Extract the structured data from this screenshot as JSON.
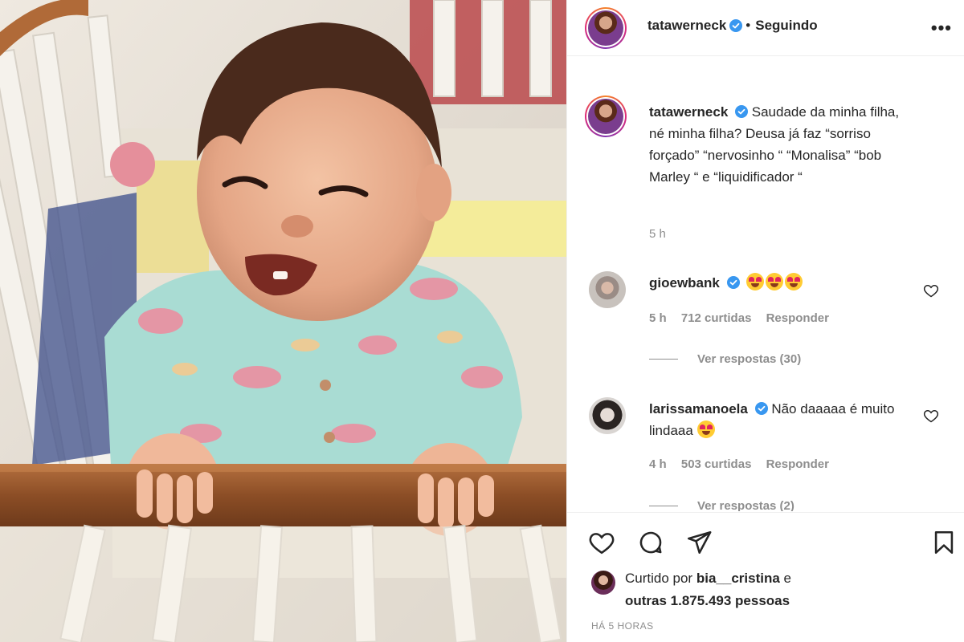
{
  "post": {
    "image_alt": "Bebê sorrindo no berço"
  },
  "header": {
    "username": "tatawerneck",
    "separator": "•",
    "follow_status": "Seguindo",
    "more_icon": "more-options-icon"
  },
  "caption": {
    "username": "tatawerneck",
    "text": "Saudade da minha filha, né minha filha? Deusa já faz “sorriso forçado” “nervosinho “ “Monalisa” “bob Marley “ e “liquidificador “",
    "time": "5 h"
  },
  "comments": [
    {
      "username": "gioewbank",
      "text": "",
      "emoji_count": 3,
      "time": "5 h",
      "likes": "712 curtidas",
      "reply_label": "Responder",
      "view_replies": "Ver respostas (30)"
    },
    {
      "username": "larissamanoela",
      "text": "Não daaaaa é muito lindaaa",
      "emoji_count": 1,
      "time": "4 h",
      "likes": "503 curtidas",
      "reply_label": "Responder",
      "view_replies": "Ver respostas (2)"
    }
  ],
  "actions": {
    "like_icon": "heart-icon",
    "comment_icon": "comment-icon",
    "share_icon": "share-icon",
    "save_icon": "bookmark-icon"
  },
  "likes": {
    "prefix": "Curtido por",
    "user": "bia__cristina",
    "mid": "e",
    "others": "outras 1.875.493 pessoas"
  },
  "timestamp": "HÁ 5 HORAS",
  "colors": {
    "text": "#262626",
    "muted": "#8e8e8e",
    "verified": "#3897f0",
    "border": "#efefef"
  }
}
